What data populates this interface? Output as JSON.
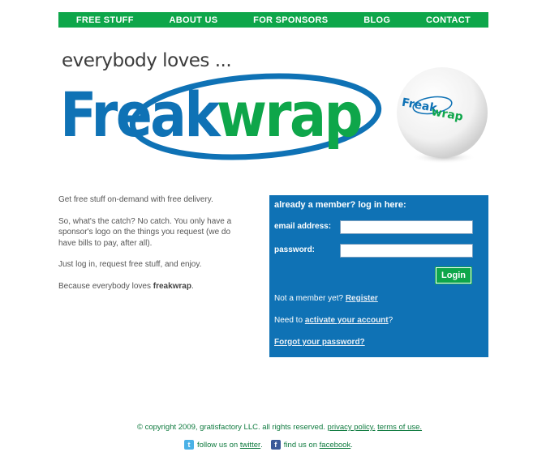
{
  "nav": {
    "items": [
      {
        "label": "FREE STUFF"
      },
      {
        "label": "ABOUT US"
      },
      {
        "label": "FOR SPONSORS"
      },
      {
        "label": "BLOG"
      },
      {
        "label": "CONTACT"
      }
    ]
  },
  "brand": {
    "tagline": "everybody loves ...",
    "logo_part1": "Freak",
    "logo_part2": "wrap",
    "ball_part1": "Freak",
    "ball_part2": "wrap",
    "blue": "#0f72b5",
    "green": "#0ea64a"
  },
  "intro": {
    "p1": "Get free stuff on-demand with free delivery.",
    "p2": "So, what's the catch? No catch. You only have a sponsor's logo on the things you request (we do have bills to pay, after all).",
    "p3": "Just log in, request free stuff, and enjoy.",
    "p4_prefix": "Because everybody loves ",
    "p4_bold": "freakwrap",
    "p4_suffix": "."
  },
  "login": {
    "title": "already a member? log in here:",
    "email_label": "email address:",
    "email_value": "",
    "password_label": "password:",
    "password_value": "",
    "button": "Login",
    "register_prefix": "Not a member yet? ",
    "register_link": "Register",
    "activate_prefix": "Need to ",
    "activate_link": "activate your account",
    "activate_suffix": "?",
    "forgot_link": "Forgot your password?"
  },
  "footer": {
    "copyright": "© copyright 2009, gratisfactory LLC. all rights reserved.",
    "privacy": "privacy policy.",
    "terms": "terms of use.",
    "twitter_prefix": "follow us on ",
    "twitter_link": "twitter",
    "twitter_suffix": ".",
    "facebook_prefix": "find us on ",
    "facebook_link": "facebook",
    "facebook_suffix": ".",
    "twitter_icon": "twitter-icon",
    "facebook_icon": "facebook-icon"
  }
}
